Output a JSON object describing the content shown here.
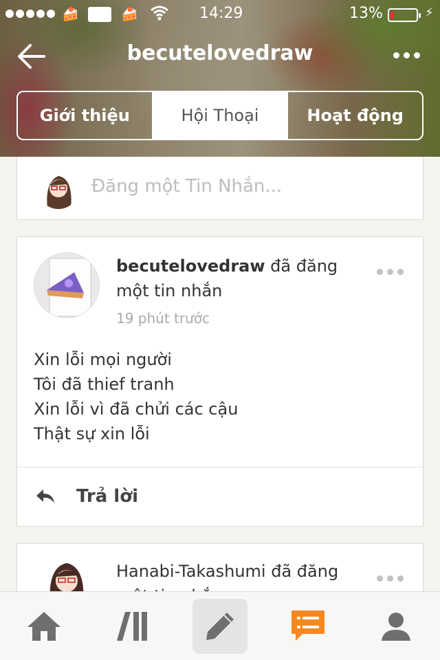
{
  "status_bar": {
    "time": "14:29",
    "battery_percent": "13%",
    "battery_level": 0.13,
    "icons": [
      "signal-dots-icon",
      "cake-icon",
      "carrier-logo",
      "cake-icon",
      "wifi-icon",
      "battery-icon",
      "charging-bolt-icon"
    ]
  },
  "nav": {
    "title": "becutelovedraw",
    "back_icon": "back-arrow-icon",
    "more_icon": "more-horizontal-icon"
  },
  "tabs": [
    {
      "label": "Giới thiệu",
      "active": false
    },
    {
      "label": "Hội Thoại",
      "active": true
    },
    {
      "label": "Hoạt động",
      "active": false
    }
  ],
  "composer": {
    "placeholder": "Đăng một Tin Nhắn..."
  },
  "posts": [
    {
      "author": "becutelovedraw",
      "action": " đã đăng một tin nhắn",
      "time": "19 phút trước",
      "lines": [
        "Xin lỗi mọi người",
        "Tôi đã thief tranh",
        "Xin lỗi vì đã chửi các cậu",
        "Thật sự xin lỗi"
      ],
      "reply_label": "Trả lời"
    },
    {
      "author": "Hanabi-Takashumi",
      "action": " đã đăng",
      "action_cont": "một tin nhắn"
    }
  ],
  "tab_bar": {
    "items": [
      "home-icon",
      "catalog-icon",
      "compose-icon",
      "chat-icon",
      "profile-icon"
    ],
    "active": "chat-icon"
  },
  "colors": {
    "accent": "#f7871f",
    "battery_low": "#e0312b",
    "icon_gray": "#6f6f6f"
  }
}
